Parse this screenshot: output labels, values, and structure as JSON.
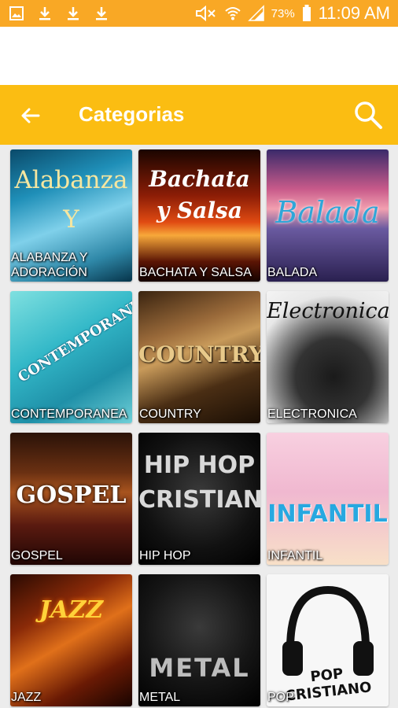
{
  "status_bar": {
    "battery": "73%",
    "time": "11:09 AM",
    "left_icons": [
      "image-icon",
      "download-icon",
      "download-icon",
      "download-icon"
    ],
    "right_icons": [
      "mute-icon",
      "wifi-icon",
      "signal-icon",
      "battery-icon"
    ]
  },
  "app_bar": {
    "title": "Categorias",
    "back_icon": "arrow-left-icon",
    "search_icon": "search-icon",
    "color": "#fbbd12"
  },
  "categories": [
    {
      "label": "ALABANZA Y ADORACIÓN",
      "art_text": "Alabanza Y"
    },
    {
      "label": "BACHATA Y SALSA",
      "art_text": "Bachata y Salsa"
    },
    {
      "label": "BALADA",
      "art_text": "Balada"
    },
    {
      "label": "CONTEMPORANEA",
      "art_text": "CONTEMPORANEA"
    },
    {
      "label": "COUNTRY",
      "art_text": "COUNTRY"
    },
    {
      "label": "ELECTRONICA",
      "art_text": "Electronica"
    },
    {
      "label": "GOSPEL",
      "art_text": "GOSPEL"
    },
    {
      "label": "HIP HOP",
      "art_text": "HIP HOP CRISTIANO"
    },
    {
      "label": "INFANTIL",
      "art_text": "INFANTIL"
    },
    {
      "label": "JAZZ",
      "art_text": "JAZZ"
    },
    {
      "label": "METAL",
      "art_text": "METAL"
    },
    {
      "label": "POP",
      "art_text": "POP CRISTIANO"
    }
  ]
}
